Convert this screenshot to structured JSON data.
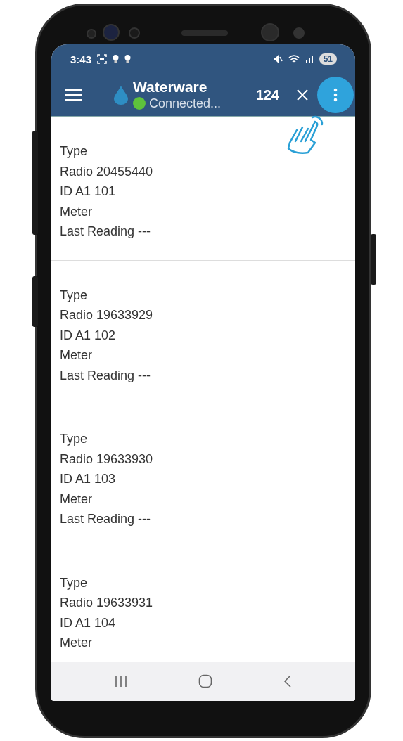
{
  "status_bar": {
    "time": "3:43",
    "battery": "51"
  },
  "app_bar": {
    "title": "Waterware",
    "status": "Connected...",
    "count": "124"
  },
  "items": [
    {
      "lines": [
        "Type",
        "Radio 20455440",
        "ID A1 101",
        "Meter",
        "Last Reading ---"
      ]
    },
    {
      "lines": [
        "Type",
        "Radio 19633929",
        "ID A1 102",
        "Meter",
        "Last Reading ---"
      ]
    },
    {
      "lines": [
        "Type",
        "Radio 19633930",
        "ID A1 103",
        "Meter",
        "Last Reading ---"
      ]
    },
    {
      "lines": [
        "Type",
        "Radio 19633931",
        "ID A1 104",
        "Meter"
      ]
    }
  ]
}
